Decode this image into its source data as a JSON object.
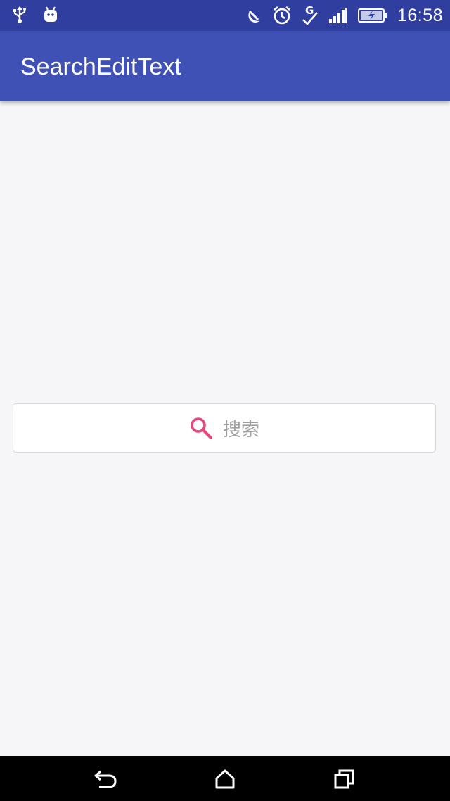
{
  "status_bar": {
    "time": "16:58",
    "icons": [
      "usb-icon",
      "android-debug-icon",
      "do-not-disturb-moon-icon",
      "alarm-clock-icon",
      "g-network-check-icon",
      "signal-bars-icon",
      "battery-charging-icon"
    ]
  },
  "app_bar": {
    "title": "SearchEditText"
  },
  "search": {
    "placeholder": "搜索",
    "icon": "search-icon",
    "icon_color": "#e5467c"
  },
  "nav_bar": {
    "icons": [
      "back-icon",
      "home-icon",
      "recent-apps-icon"
    ]
  },
  "colors": {
    "status_bar": "#303f9f",
    "app_bar": "#3f51b5",
    "background": "#f6f6f8"
  }
}
